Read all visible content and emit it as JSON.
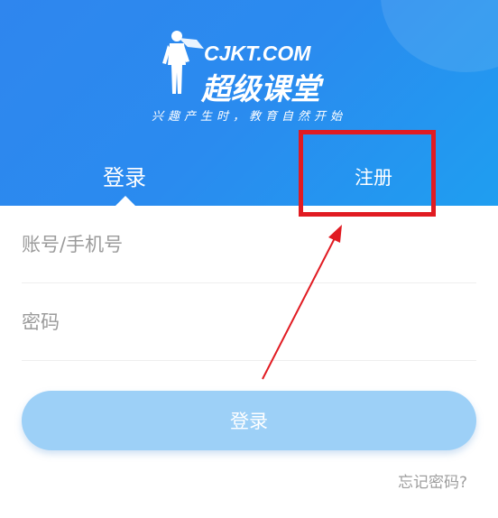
{
  "logo": {
    "domain": "CJKT.COM",
    "name": "超级课堂",
    "slogan": "兴趣产生时，教育自然开始"
  },
  "tabs": [
    {
      "label": "登录",
      "active": true
    },
    {
      "label": "注册",
      "active": false
    }
  ],
  "form": {
    "account_placeholder": "账号/手机号",
    "password_placeholder": "密码",
    "login_button": "登录",
    "forgot_link": "忘记密码?"
  },
  "annotation": {
    "highlight_color": "#e11b22"
  },
  "colors": {
    "header_blue": "#2a8bef",
    "button_disabled": "#9dd0f7",
    "hint_gray": "#9e9e9e"
  }
}
